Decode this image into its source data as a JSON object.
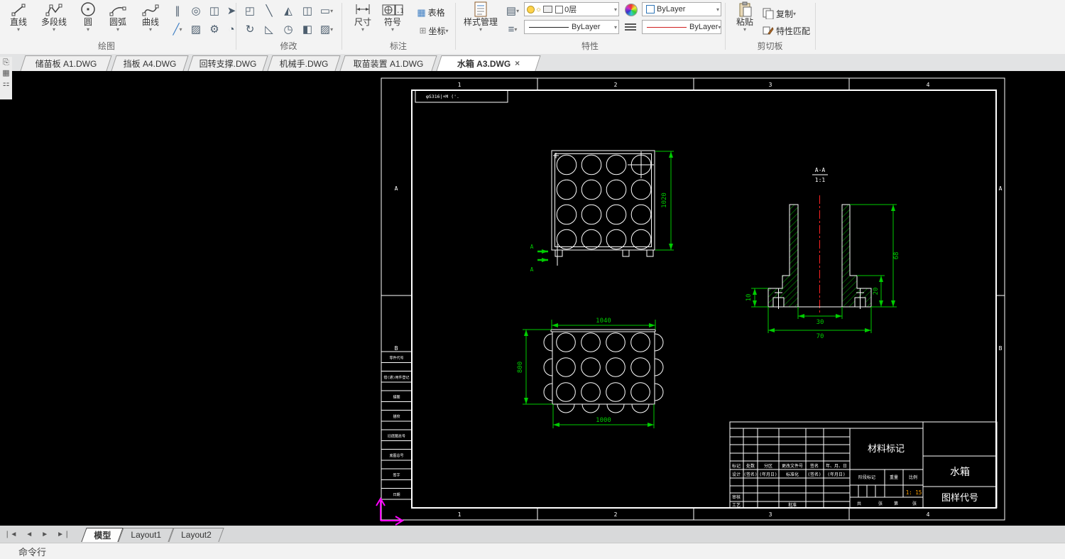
{
  "ribbon": {
    "draw": {
      "label": "绘图",
      "line": "直线",
      "polyline": "多段线",
      "circle": "圆",
      "arc": "圆弧",
      "spline": "曲线"
    },
    "modify": {
      "label": "修改"
    },
    "annotate": {
      "label": "标注",
      "dimension": "尺寸",
      "symbol": "符号",
      "table": "表格",
      "coordinate": "坐标"
    },
    "properties": {
      "label": "特性",
      "style_manager": "样式管理",
      "layer": "0层",
      "color": "ByLayer",
      "linetype": "ByLayer",
      "linetype_red": "ByLayer"
    },
    "clipboard": {
      "label": "剪切板",
      "paste": "粘贴",
      "copy": "复制",
      "match_properties": "特性匹配"
    }
  },
  "doc_tabs": [
    {
      "label": "储苗板 A1.DWG"
    },
    {
      "label": "挡板 A4.DWG"
    },
    {
      "label": "回转支撑.DWG"
    },
    {
      "label": "机械手.DWG"
    },
    {
      "label": "取苗装置 A1.DWG"
    },
    {
      "label": "水箱 A3.DWG",
      "close": "×"
    }
  ],
  "layout_bar": {
    "model": "模型",
    "layout1": "Layout1",
    "layout2": "Layout2"
  },
  "command_line": "命令行",
  "sheet": {
    "note": "φS316|+M ('.",
    "zones_top": [
      "1",
      "2",
      "3",
      "4"
    ],
    "zones_bottom": [
      "1",
      "2",
      "3",
      "4"
    ],
    "zone_letters": [
      "A",
      "B"
    ]
  },
  "views": {
    "front": {
      "dim_height": "1020",
      "section_label": "A"
    },
    "plan": {
      "dim_top": "1040",
      "dim_left": "800",
      "dim_bottom": "1000"
    },
    "section": {
      "label": "A-A",
      "scale": "1:1",
      "dim_height": "68",
      "dim_step": "20",
      "dim_flange": "10",
      "dim_bore": "30",
      "dim_width": "70"
    }
  },
  "title_block": {
    "material": "材料标记",
    "part": "水箱",
    "code": "图样代号",
    "scale_value": "1: 15",
    "header": [
      "标记",
      "处数",
      "分区",
      "更改文件号",
      "签名",
      "年、月、日"
    ],
    "design_row": [
      "设计",
      "(签名)",
      "(年月日)",
      "标准化",
      "(签名)",
      "(年月日)"
    ],
    "audit": "审核",
    "process": "工艺",
    "approve": "批准",
    "stage": "阶段标记",
    "weight": "重量",
    "scale_label": "比例",
    "sheets": [
      "共",
      "张",
      "第",
      "张"
    ]
  },
  "side_column": [
    "零件代号",
    "借(通)用件登记",
    "描图",
    "描校",
    "旧底图总号",
    "底图总号",
    "签字",
    "日期"
  ],
  "colors": {
    "dimension_green": "#00cc00",
    "centerline_red": "#ff2222",
    "ucs_magenta": "#ff00ff",
    "scale_orange": "#ffa000",
    "line_white": "#ffffff"
  }
}
